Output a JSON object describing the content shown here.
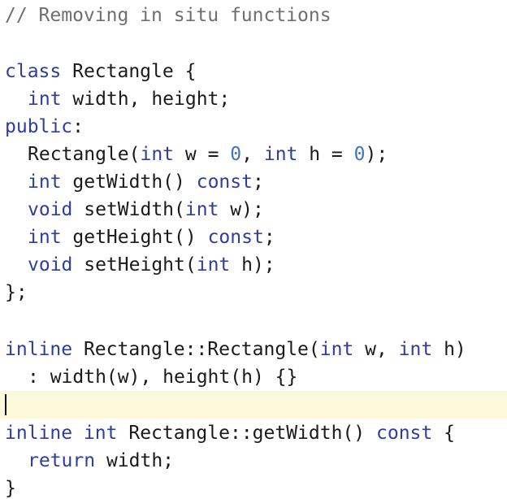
{
  "editor": {
    "colors": {
      "keyword": "#2f3d9d",
      "number": "#3f73c4",
      "comment": "#6f6f6f",
      "text": "#1a1a1a",
      "current_line": "#fbf9da"
    },
    "line1": {
      "comment": "// Removing in situ functions"
    },
    "line3": {
      "kw_class": "class",
      "t1": " Rectangle {"
    },
    "line4": {
      "kw_int": "int",
      "t1": " width, height;"
    },
    "line5": {
      "kw_public": "public",
      "t1": ":"
    },
    "line6": {
      "t1": "Rectangle(",
      "kw_int1": "int",
      "t2": " w = ",
      "n1": "0",
      "t3": ", ",
      "kw_int2": "int",
      "t4": " h = ",
      "n2": "0",
      "t5": ");"
    },
    "line7": {
      "kw_int": "int",
      "t1": " getWidth() ",
      "kw_const": "const",
      "t2": ";"
    },
    "line8": {
      "kw_void": "void",
      "t1": " setWidth(",
      "kw_int": "int",
      "t2": " w);"
    },
    "line9": {
      "kw_int": "int",
      "t1": " getHeight() ",
      "kw_const": "const",
      "t2": ";"
    },
    "line10": {
      "kw_void": "void",
      "t1": " setHeight(",
      "kw_int": "int",
      "t2": " h);"
    },
    "line11": {
      "t1": "};"
    },
    "line13": {
      "kw_inline": "inline",
      "t1": " Rectangle::Rectangle(",
      "kw_int1": "int",
      "t2": " w, ",
      "kw_int2": "int",
      "t3": " h)"
    },
    "line14": {
      "t1": ": width(w), height(h) {}"
    },
    "line16": {
      "kw_inline": "inline",
      "t1": " ",
      "kw_int": "int",
      "t2": " Rectangle::getWidth() ",
      "kw_const": "const",
      "t3": " {"
    },
    "line17": {
      "kw_return": "return",
      "t1": " width;"
    },
    "line18": {
      "t1": "}"
    }
  }
}
